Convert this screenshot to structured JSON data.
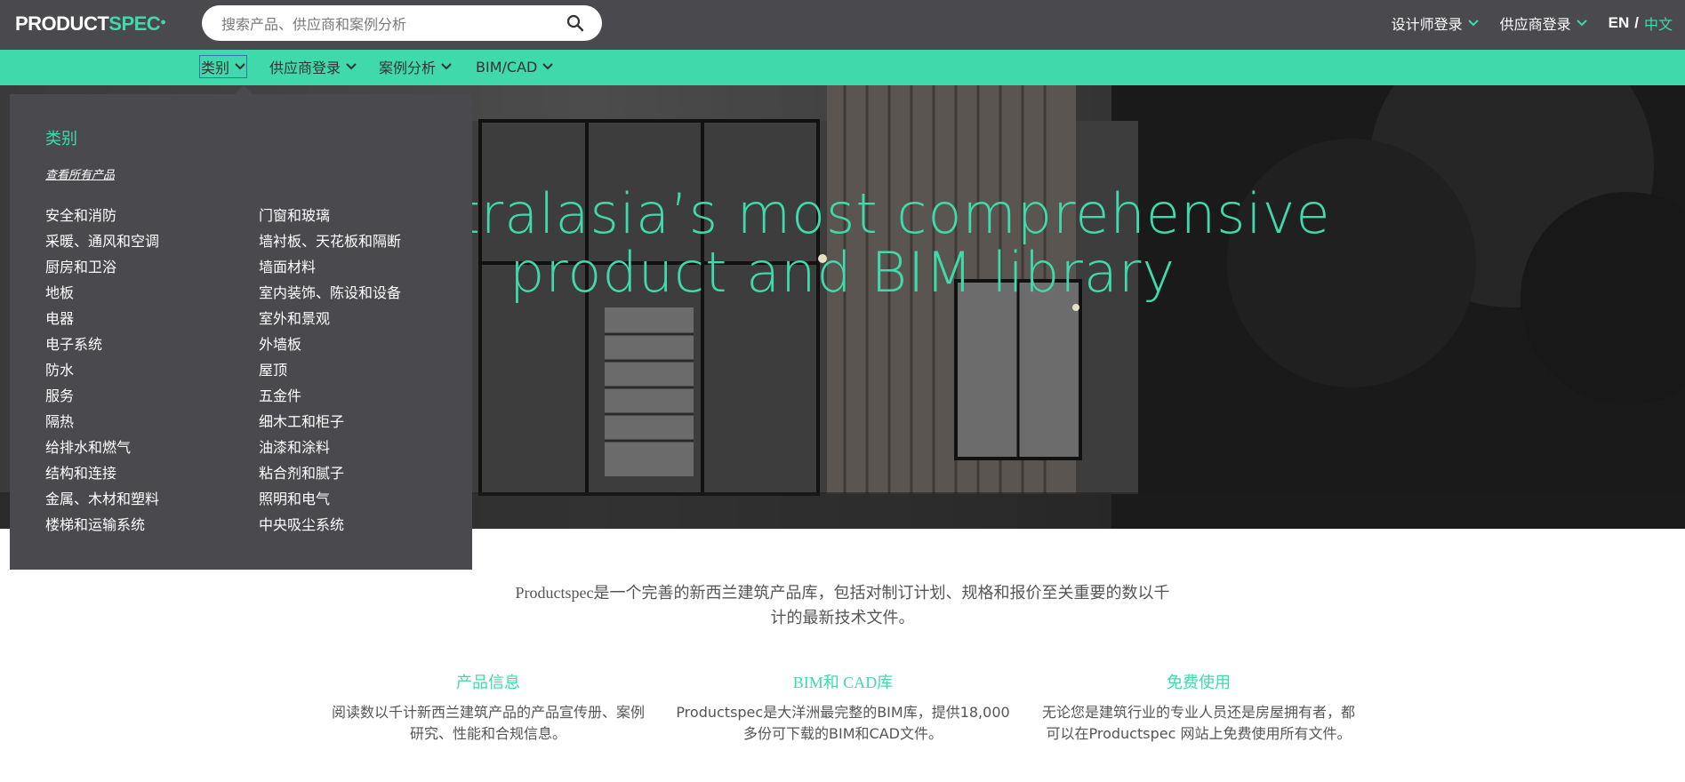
{
  "header": {
    "logo": {
      "product": "PRODUCT",
      "spec": "SPEC"
    },
    "search": {
      "placeholder": "搜索产品、供应商和案例分析",
      "value": ""
    },
    "menus": [
      {
        "label": "设计师登录"
      },
      {
        "label": "供应商登录"
      }
    ],
    "language": {
      "en": "EN",
      "separator": "/",
      "zh": "中文"
    }
  },
  "nav": {
    "items": [
      {
        "label": "类别"
      },
      {
        "label": "供应商登录"
      },
      {
        "label": "案例分析"
      },
      {
        "label": "BIM/CAD"
      }
    ]
  },
  "hero": {
    "title_line1": "Australasia’s most comprehensive",
    "title_line2": "product and BIM library"
  },
  "dropdown": {
    "title": "类别",
    "view_all": "查看所有产品",
    "column1": [
      "安全和消防",
      "采暖、通风和空调",
      "厨房和卫浴",
      "地板",
      "电器",
      "电子系统",
      "防水",
      "服务",
      "隔热",
      "给排水和燃气",
      "结构和连接",
      "金属、木材和塑料",
      "楼梯和运输系统"
    ],
    "column2": [
      "门窗和玻璃",
      "墙衬板、天花板和隔断",
      "墙面材料",
      "室内装饰、陈设和设备",
      "室外和景观",
      "外墙板",
      "屋顶",
      "五金件",
      "细木工和柜子",
      "油漆和涂料",
      "粘合剂和腻子",
      "照明和电气",
      "中央吸尘系统"
    ]
  },
  "intro": {
    "line1": "Productspec是一个完善的新西兰建筑产品库，包括对制订计划、规格和报价至关重要的数以千",
    "line2": "计的最新技术文件。"
  },
  "features": [
    {
      "title": "产品信息",
      "line1": "阅读数以千计新西兰建筑产品的产品宣传册、案例",
      "line2": "研究、性能和合规信息。"
    },
    {
      "title": "BIM和 CAD库",
      "line1": "Productspec是大洋洲最完整的BIM库，提供18,000",
      "line2": "多份可下载的BIM和CAD文件。"
    },
    {
      "title": "免费使用",
      "line1": "无论您是建筑行业的专业人员还是房屋拥有者，都",
      "line2": "可以在Productspec 网站上免费使用所有文件。"
    }
  ],
  "colors": {
    "accent": "#40d9ac",
    "dark": "#4a4a4e"
  }
}
